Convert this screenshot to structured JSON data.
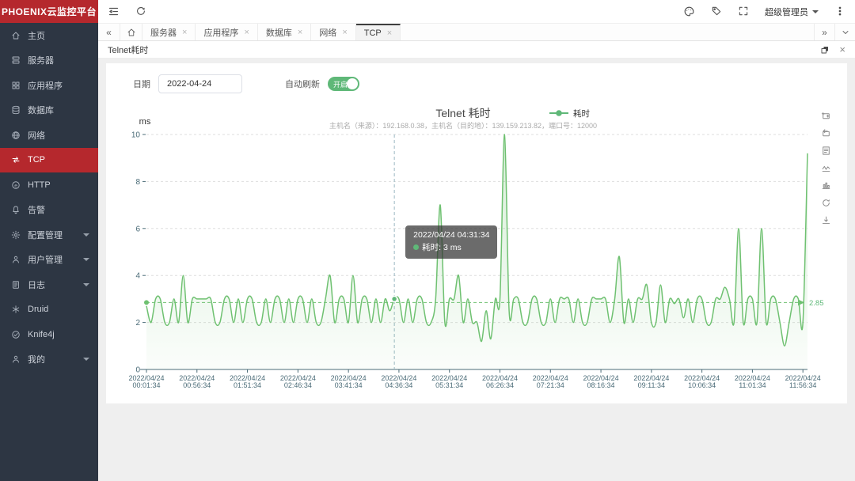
{
  "app": {
    "title": "PHOENIX云监控平台"
  },
  "colors": {
    "brand": "#b5282d",
    "green": "#5fb878",
    "line": "#6fc171"
  },
  "topbar": {
    "user_label": "超级管理员",
    "icons": [
      "palette-icon",
      "tag-icon",
      "fullscreen-icon",
      "more-vert-icon"
    ]
  },
  "sidebar": {
    "items": [
      {
        "key": "home",
        "icon": "home",
        "label": "主页"
      },
      {
        "key": "server",
        "icon": "server",
        "label": "服务器"
      },
      {
        "key": "apps",
        "icon": "apps",
        "label": "应用程序"
      },
      {
        "key": "database",
        "icon": "database",
        "label": "数据库"
      },
      {
        "key": "network",
        "icon": "network",
        "label": "网络"
      },
      {
        "key": "tcp",
        "icon": "tcp",
        "label": "TCP",
        "active": true
      },
      {
        "key": "http",
        "icon": "http",
        "label": "HTTP"
      },
      {
        "key": "alert",
        "icon": "alert",
        "label": "告警"
      },
      {
        "key": "config",
        "icon": "config",
        "label": "配置管理",
        "children": true
      },
      {
        "key": "users",
        "icon": "user",
        "label": "用户管理",
        "children": true
      },
      {
        "key": "log",
        "icon": "log",
        "label": "日志",
        "children": true
      },
      {
        "key": "druid",
        "icon": "druid",
        "label": "Druid"
      },
      {
        "key": "knife4j",
        "icon": "knife4j",
        "label": "Knife4j"
      },
      {
        "key": "mine",
        "icon": "user",
        "label": "我的",
        "children": true
      }
    ]
  },
  "tabbar": {
    "back_label": "«",
    "forward_label": "»",
    "tabs": [
      {
        "key": "server",
        "label": "服务器"
      },
      {
        "key": "apps",
        "label": "应用程序"
      },
      {
        "key": "database",
        "label": "数据库"
      },
      {
        "key": "network",
        "label": "网络"
      },
      {
        "key": "tcp",
        "label": "TCP",
        "active": true
      }
    ],
    "close_label": "×"
  },
  "panel": {
    "title": "Telnet耗时"
  },
  "form": {
    "date_label": "日期",
    "date_value": "2022-04-24",
    "refresh_label": "自动刷新",
    "toggle_label": "开启"
  },
  "chart_data": {
    "type": "area",
    "title": "Telnet 耗时",
    "subtitle": "主机名（来源）：192.168.0.38，主机名（目的地）：139.159.213.82，端口号：12000",
    "ylabel": "ms",
    "ylim": [
      0,
      10
    ],
    "yticks": [
      0,
      2,
      4,
      6,
      8,
      10
    ],
    "grid": true,
    "legend": [
      {
        "name": "耗时",
        "color": "#5fb878",
        "position": "top"
      }
    ],
    "x_label_every": 11,
    "x_tick_labels": [
      {
        "date": "2022/04/24",
        "time": "00:01:34"
      },
      {
        "date": "2022/04/24",
        "time": "00:56:34"
      },
      {
        "date": "2022/04/24",
        "time": "01:51:34"
      },
      {
        "date": "2022/04/24",
        "time": "02:46:34"
      },
      {
        "date": "2022/04/24",
        "time": "03:41:34"
      },
      {
        "date": "2022/04/24",
        "time": "04:36:34"
      },
      {
        "date": "2022/04/24",
        "time": "05:31:34"
      },
      {
        "date": "2022/04/24",
        "time": "06:26:34"
      },
      {
        "date": "2022/04/24",
        "time": "07:21:34"
      },
      {
        "date": "2022/04/24",
        "time": "08:16:34"
      },
      {
        "date": "2022/04/24",
        "time": "09:11:34"
      },
      {
        "date": "2022/04/24",
        "time": "10:06:34"
      },
      {
        "date": "2022/04/24",
        "time": "11:01:34"
      },
      {
        "date": "2022/04/24",
        "time": "11:56:34"
      }
    ],
    "series": [
      {
        "name": "耗时",
        "color": "#6fc171",
        "values": [
          2.7,
          2,
          3,
          3,
          2,
          2,
          3,
          2,
          4,
          2,
          3,
          3,
          3,
          3,
          3,
          2,
          2,
          3,
          3,
          2,
          3,
          2,
          3,
          3,
          2,
          2,
          3,
          2,
          3,
          3,
          2,
          3,
          2,
          3,
          3,
          2,
          3,
          2,
          2,
          3,
          4,
          2,
          3,
          3,
          2,
          4,
          2,
          3,
          3,
          2,
          3,
          2,
          3,
          2.5,
          3,
          3,
          2,
          3,
          2,
          3,
          3,
          2,
          2,
          3,
          7,
          2,
          3,
          3,
          4,
          2,
          3,
          2,
          2,
          1.2,
          2.5,
          1.3,
          3,
          3,
          10,
          2.5,
          3,
          3,
          2,
          2,
          3,
          3,
          2,
          2,
          3,
          2,
          3,
          3,
          3,
          2,
          3,
          2,
          2,
          3,
          3,
          3,
          3,
          2,
          3,
          4.8,
          2,
          3,
          2,
          3,
          3,
          3.6,
          2,
          2,
          3.6,
          2,
          3,
          2.8,
          3,
          2.2,
          3,
          2,
          3,
          3,
          2,
          2,
          3,
          3,
          3.5,
          3,
          2,
          6,
          2,
          3,
          3,
          2,
          6,
          2,
          3,
          3,
          2,
          1,
          2,
          3,
          3,
          2,
          9.2
        ]
      }
    ],
    "average_line": {
      "value": 2.85,
      "label": "2.85"
    },
    "tooltip": {
      "index": 54,
      "title": "2022/04/24 04:31:34",
      "entry": "耗时",
      "value_text": "3 ms"
    },
    "toolbox": [
      "zoom-select",
      "zoom-reset",
      "data-view",
      "line-type",
      "bar-type",
      "restore",
      "download"
    ]
  }
}
